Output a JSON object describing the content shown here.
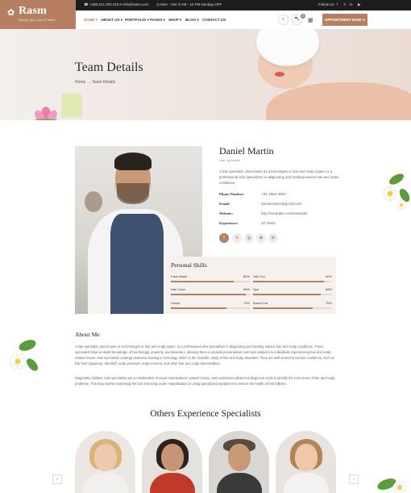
{
  "brand": {
    "name": "Rasm",
    "tagline": "Beauty Spa Care & Salon"
  },
  "topbar": {
    "phone": "+256 214 203 215",
    "email": "info@rasm.com",
    "hours": "Mon - Sat: 8 AM - 10 PM Sunday OFF",
    "follow_label": "Follow Us",
    "social": [
      "f",
      "𝕏",
      "in",
      "▶"
    ]
  },
  "nav": {
    "items": [
      "HOME",
      "ABOUT US",
      "PORTFOLIO",
      "PAGES",
      "SHOP",
      "BLOG",
      "CONTACT US"
    ],
    "cart_count": "0",
    "appointment_label": "APPOINTMENT NOW"
  },
  "hero": {
    "title": "Team Details",
    "breadcrumb_home": "Home",
    "breadcrumb_current": "Team Details"
  },
  "profile": {
    "name": "Daniel Martin",
    "role": "Hair Specialist",
    "description": "A hair specialist, also known as a trichologist or hair and scalp expert, is a professional who specializes in diagnosing and treating various hair and scalp conditions.",
    "info": [
      {
        "label": "Phone Number:",
        "value": "+92 2564 3654"
      },
      {
        "label": "Email:",
        "value": "danielmartin@gmail.com"
      },
      {
        "label": "Website:",
        "value": "http://example.com/example"
      },
      {
        "label": "Experience:",
        "value": "22 Years"
      }
    ],
    "social": [
      "f",
      "𝕏",
      "◎",
      "⊕",
      "in"
    ]
  },
  "skills": {
    "title": "Personal Skills",
    "items": [
      {
        "name": "Face Wash",
        "pct": "80%",
        "level": 0.8
      },
      {
        "name": "Hair Cut",
        "pct": "90%",
        "level": 0.9
      },
      {
        "name": "Hair Color",
        "pct": "95%",
        "level": 0.95
      },
      {
        "name": "Spa",
        "pct": "86%",
        "level": 0.86
      },
      {
        "name": "Facial",
        "pct": "70%",
        "level": 0.7
      },
      {
        "name": "Bread Cut",
        "pct": "75%",
        "level": 0.75
      }
    ]
  },
  "about": {
    "title": "About Me",
    "p1": "A hair specialist, also known as a trichologist or hair and scalp expert, is a professional who specializes in diagnosing and treating various hair and scalp conditions. These specialists have in-depth knowledge of hair biology, anatomy, and disorders, allowing them to provide personalized care and solutions to individuals experiencing hair and scalp-related issues. Hair specialists undergo extensive training in trichology, which is the scientific study of hair and scalp disorders. They are well-versed in various conditions, such as hair loss (alopecia), dandruff, scalp psoriasis, scalp eczema, and other hair and scalp abnormalities.",
    "p2": "Diagnostic Abilities: Hair specialists use a combination of visual examinations, patient history, and sometimes advanced diagnostic tools to identify the root cause of hair and scalp problems. This may involve examining the hair and scalp under magnification or using specialized equipment to assess the health of hair follicles."
  },
  "others": {
    "title": "Others Experience Specialists",
    "prev": "‹",
    "next": "›"
  }
}
